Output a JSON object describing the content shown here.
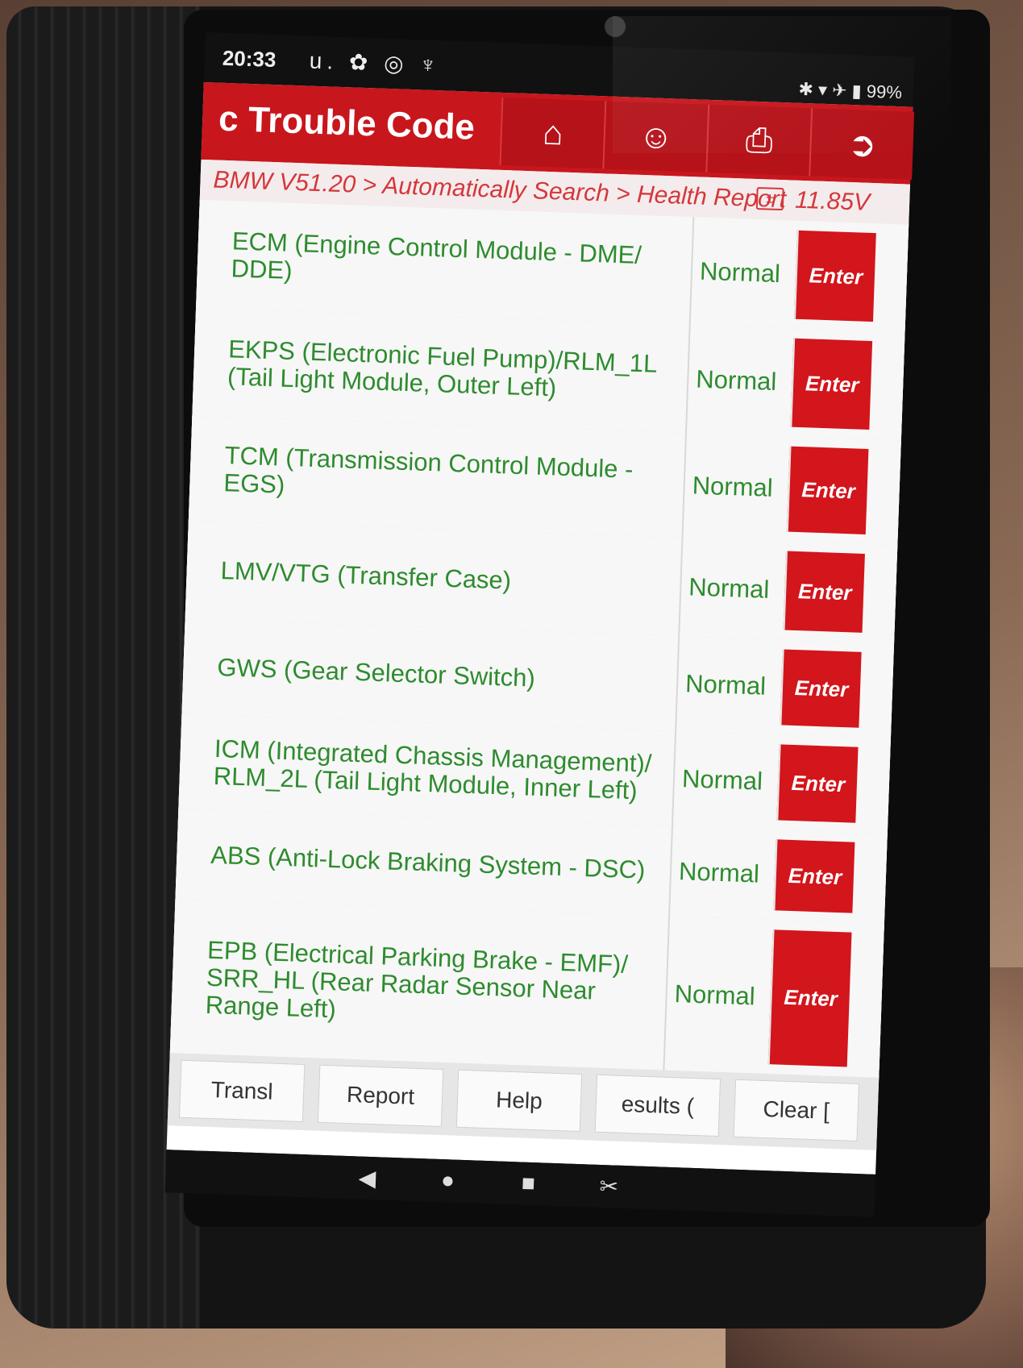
{
  "status_bar": {
    "time": "20:33",
    "left_icons": "u. ✿ ◎ ♆",
    "right_icons": "✱ ▾ ✈ ▮",
    "battery": "99%"
  },
  "header": {
    "title": "c Trouble Code",
    "home_icon": "home-icon",
    "support_icon": "support-icon",
    "print_icon": "print-icon",
    "exit_icon": "exit-icon"
  },
  "breadcrumb": {
    "path": "BMW V51.20 > Automatically Search > Health Report",
    "voltage": "11.85V"
  },
  "modules": [
    {
      "name": "ECM (Engine Control Module - DME/ DDE)",
      "status": "Normal",
      "action": "Enter"
    },
    {
      "name": "EKPS (Electronic Fuel Pump)/RLM_1L (Tail Light Module, Outer Left)",
      "status": "Normal",
      "action": "Enter"
    },
    {
      "name": "TCM (Transmission Control Module - EGS)",
      "status": "Normal",
      "action": "Enter"
    },
    {
      "name": "LMV/VTG (Transfer Case)",
      "status": "Normal",
      "action": "Enter"
    },
    {
      "name": "GWS (Gear Selector Switch)",
      "status": "Normal",
      "action": "Enter"
    },
    {
      "name": "ICM (Integrated Chassis Management)/ RLM_2L (Tail Light Module, Inner Left)",
      "status": "Normal",
      "action": "Enter"
    },
    {
      "name": "ABS (Anti-Lock Braking System - DSC)",
      "status": "Normal",
      "action": "Enter"
    },
    {
      "name": "EPB (Electrical Parking Brake - EMF)/ SRR_HL (Rear Radar Sensor Near Range Left)",
      "status": "Normal",
      "action": "Enter"
    }
  ],
  "footer": {
    "buttons": [
      "Transl",
      "Report",
      "Help",
      "esults (",
      "Clear ["
    ]
  },
  "nav": {
    "back": "◀",
    "home": "●",
    "recents": "■",
    "screenshot": "✂"
  }
}
